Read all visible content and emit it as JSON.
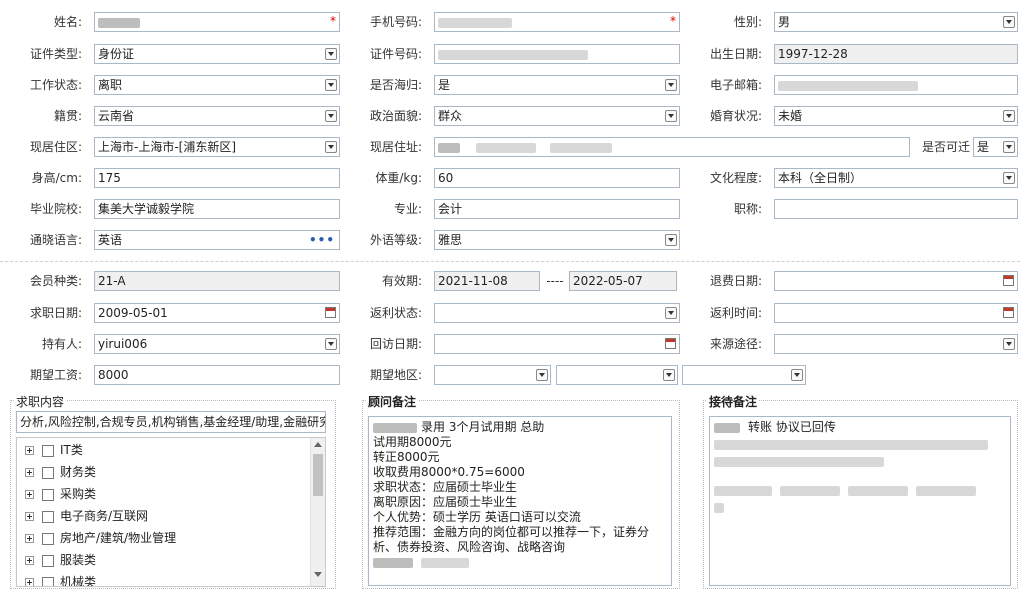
{
  "labels": {
    "name": "姓名:",
    "mobile": "手机号码:",
    "gender": "性别:",
    "id_type": "证件类型:",
    "id_no": "证件号码:",
    "birth": "出生日期:",
    "work_status": "工作状态:",
    "overseas": "是否海归:",
    "email": "电子邮箱:",
    "native_place": "籍贯:",
    "political": "政治面貌:",
    "marital": "婚育状况:",
    "residence_area": "现居住区:",
    "residence_addr": "现居住址:",
    "relocate": "是否可迁",
    "height": "身高/cm:",
    "weight": "体重/kg:",
    "education": "文化程度:",
    "school": "毕业院校:",
    "major": "专业:",
    "title": "职称:",
    "language": "通晓语言:",
    "foreign_level": "外语等级:",
    "member_type": "会员种类:",
    "valid": "有效期:",
    "refund_date": "退费日期:",
    "job_date": "求职日期:",
    "rebate_status": "返利状态:",
    "rebate_time": "返利时间:",
    "holder": "持有人:",
    "visit_date": "回访日期:",
    "source": "来源途径:",
    "salary": "期望工资:",
    "region": "期望地区:"
  },
  "values": {
    "gender": "男",
    "id_type": "身份证",
    "birth": "1997-12-28",
    "work_status": "离职",
    "overseas": "是",
    "native_place": "云南省",
    "political": "群众",
    "marital": "未婚",
    "residence_area": "上海市-上海市-[浦东新区]",
    "relocate": "是",
    "height": "175",
    "weight": "60",
    "education": "本科（全日制）",
    "school": "集美大学诚毅学院",
    "major": "会计",
    "title": "",
    "language": "英语",
    "foreign_level": "雅思",
    "member_type": "21-A",
    "valid_from": "2021-11-08",
    "valid_sep": "----",
    "valid_to": "2022-05-07",
    "job_date": "2009-05-01",
    "holder": "yirui006",
    "salary": "8000"
  },
  "panels": {
    "job": {
      "title": "求职内容",
      "summary": "分析,风险控制,合规专员,机构销售,基金经理/助理,金融研究",
      "tree": [
        "IT类",
        "财务类",
        "采购类",
        "电子商务/互联网",
        "房地产/建筑/物业管理",
        "服装类",
        "机械类"
      ]
    },
    "advisor": {
      "title": "顾问备注",
      "lines": [
        "录用  3个月试用期  总助",
        "试用期8000元",
        "转正8000元",
        "收取费用8000*0.75=6000",
        "求职状态：应届硕士毕业生",
        "离职原因：应届硕士毕业生",
        "个人优势：硕士学历 英语口语可以交流",
        "推荐范围：金融方向的岗位都可以推荐一下，证券分",
        "析、债券投资、风险咨询、战略咨询"
      ]
    },
    "reception": {
      "title": "接待备注",
      "first_line": "转账  协议已回传"
    }
  },
  "colors": {
    "required": "#dd0000",
    "border": "#a9b7c6",
    "readonly_bg": "#f0f0f0"
  }
}
